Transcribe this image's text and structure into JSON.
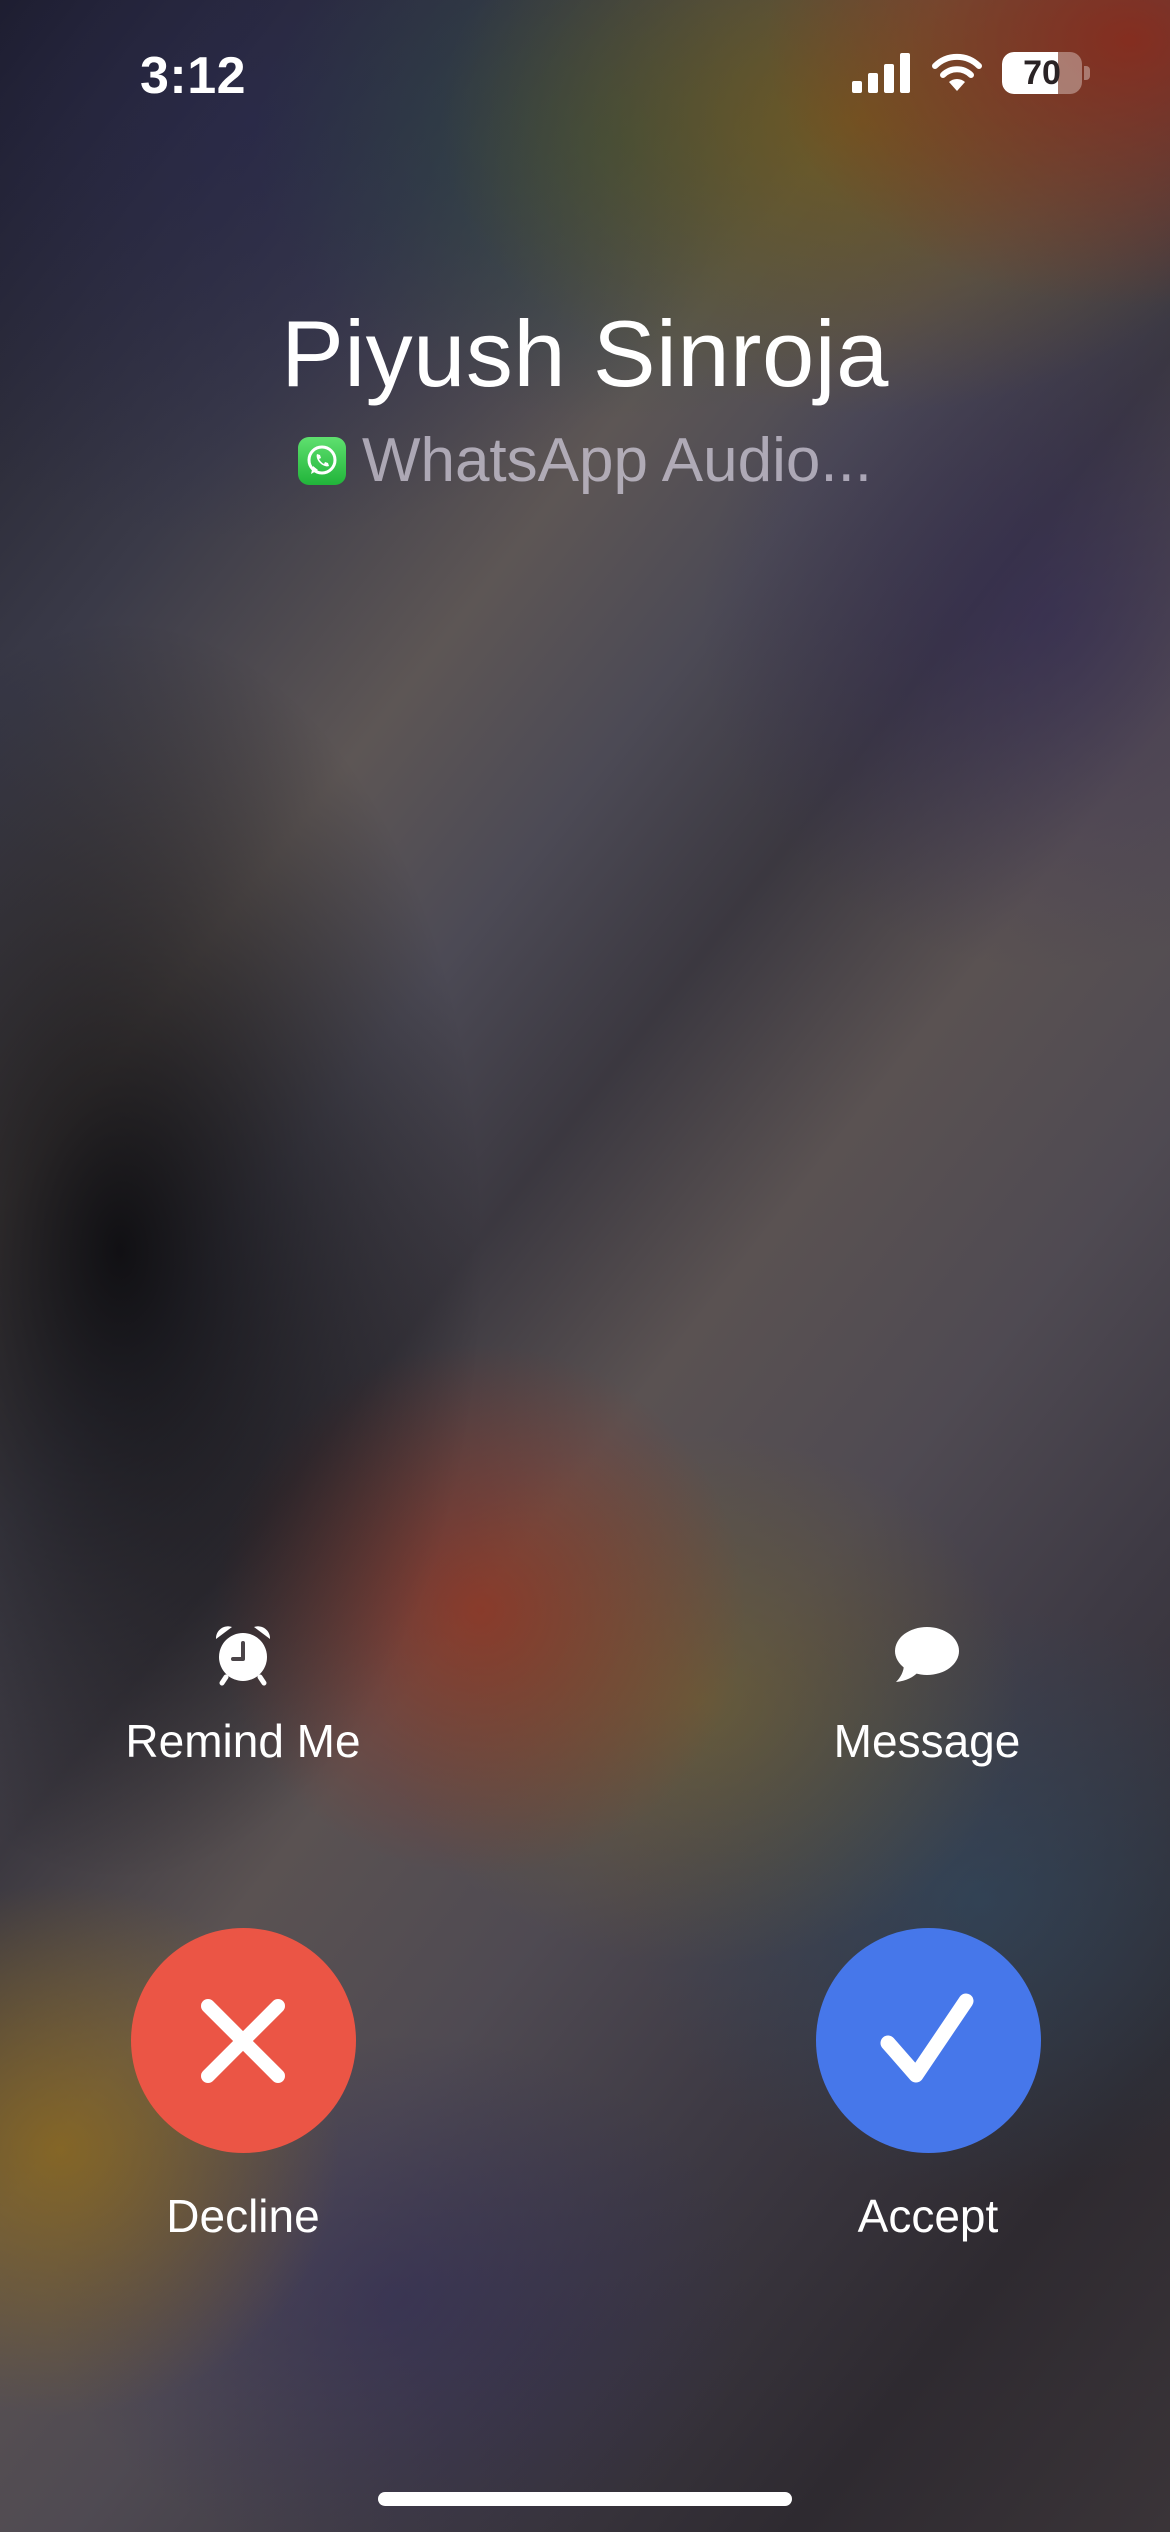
{
  "status_bar": {
    "time": "3:12",
    "battery_level": "70",
    "battery_fraction": 0.7,
    "icons": [
      "signal-icon",
      "wifi-icon",
      "battery-icon"
    ]
  },
  "caller": {
    "name": "Piyush Sinroja",
    "call_type": "WhatsApp Audio...",
    "app_icon": "whatsapp-icon"
  },
  "secondary_actions": {
    "remind": {
      "label": "Remind Me",
      "icon": "alarm-clock-icon"
    },
    "message": {
      "label": "Message",
      "icon": "message-bubble-icon"
    }
  },
  "call_actions": {
    "decline": {
      "label": "Decline",
      "icon": "close-icon",
      "color": "#eb5545"
    },
    "accept": {
      "label": "Accept",
      "icon": "checkmark-icon",
      "color": "#4677ea"
    }
  }
}
